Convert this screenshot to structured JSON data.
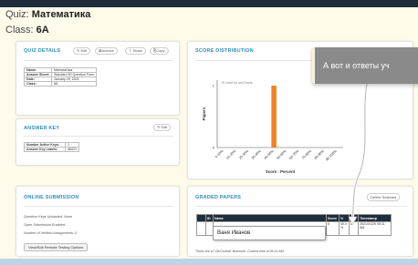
{
  "header": {
    "quiz_prefix": "Quiz:",
    "quiz_name": "Математика",
    "class_prefix": "Class:",
    "class_name": "6A"
  },
  "quiz_details": {
    "title": "QUIZ DETAILS",
    "actions": [
      "✎ Edit",
      "⊠Archive",
      "⇧ Share",
      "⎘Copy"
    ],
    "rows": [
      {
        "label": "Name:",
        "value": "Математика"
      },
      {
        "label": "Answer Sheet:",
        "value": "Standard 50 Question Form"
      },
      {
        "label": "Date:",
        "value": "January 29, 2021"
      },
      {
        "label": "Class:",
        "value": "6A"
      }
    ]
  },
  "answer_key": {
    "title": "ANSWER KEY",
    "edit_label": "✎ Edit",
    "rows": [
      {
        "label": "Number Active Keys:",
        "value": "1"
      },
      {
        "label": "Answer Key Labels:",
        "value": "ABCD"
      }
    ]
  },
  "online_submission": {
    "title": "ONLINE SUBMISSION",
    "lines": [
      "Question Keys Uploaded: None",
      "Open Submission Enabled: -",
      "Number of Verified Assignments: 0"
    ],
    "button_label": "View/Edit Remote Testing Options"
  },
  "score_distribution": {
    "title": "SCORE DISTRIBUTION",
    "chart_credit": "JS chart by amCharts",
    "tooltip_text": "А вот и ответы уч"
  },
  "graded_papers": {
    "title": "GRADED PAPERS",
    "delete_label": "Delete Selected",
    "columns": [
      "",
      "ID",
      "Name",
      "Score",
      "%",
      "Key",
      "Timestamp"
    ],
    "rows": [
      {
        "id": "",
        "name": "Ваня Иванов",
        "score": "0",
        "pct": "40.0 %",
        "key": "A",
        "timestamp": "2021/01/29 05:11 AM"
      }
    ],
    "timezone_note": "Times are in 'US/Central' timezone. Current time is 05:14 AM."
  },
  "chart_data": {
    "type": "bar",
    "xlabel": "Score : Percent",
    "ylabel": "Papers",
    "ylim": [
      0,
      1
    ],
    "y_ticks": [
      "0",
      "1"
    ],
    "categories": [
      "0-10%",
      "10-20%",
      "20-30%",
      "30-40%",
      "40-50%",
      "50-60%",
      "60-70%",
      "70-80%",
      "80-90%",
      "90-100%"
    ],
    "values": [
      0,
      0,
      0,
      0,
      1,
      0,
      0,
      0,
      0,
      0
    ],
    "bar_color": "#f5821f"
  }
}
